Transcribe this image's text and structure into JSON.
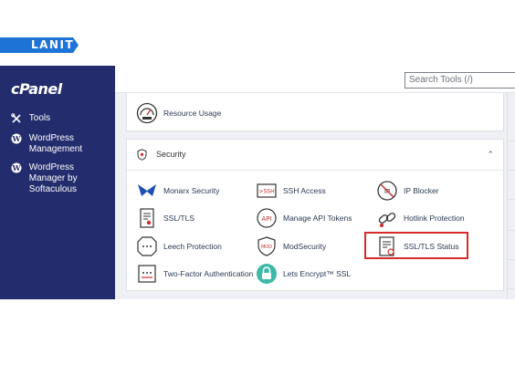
{
  "brand": {
    "lanit_logo": "LANIT",
    "cpanel_logo": "cPanel"
  },
  "sidebar": {
    "items": [
      {
        "label": "Tools",
        "icon": "tools-icon"
      },
      {
        "label": "WordPress Management",
        "icon": "wordpress-icon"
      },
      {
        "label": "WordPress Manager by Softaculous",
        "icon": "wordpress-icon"
      }
    ]
  },
  "search": {
    "placeholder": "Search Tools (/)"
  },
  "resource": {
    "label": "Resource Usage",
    "icon": "gauge-icon"
  },
  "security": {
    "title": "Security",
    "tools": [
      {
        "label": "Monarx Security",
        "icon": "monarx-icon"
      },
      {
        "label": "SSH Access",
        "icon": "ssh-icon"
      },
      {
        "label": "IP Blocker",
        "icon": "ip-blocker-icon"
      },
      {
        "label": "SSL/TLS",
        "icon": "certificate-icon"
      },
      {
        "label": "Manage API Tokens",
        "icon": "api-icon"
      },
      {
        "label": "Hotlink Protection",
        "icon": "link-icon"
      },
      {
        "label": "Leech Protection",
        "icon": "leech-icon"
      },
      {
        "label": "ModSecurity",
        "icon": "modsecurity-icon"
      },
      {
        "label": "SSL/TLS Status",
        "icon": "ssl-status-icon"
      },
      {
        "label": "Two-Factor Authentication",
        "icon": "two-factor-icon"
      },
      {
        "label": "Lets Encrypt™ SSL",
        "icon": "lock-icon"
      }
    ]
  },
  "colors": {
    "sidebar_bg": "#232d6d",
    "lanit_blue": "#1e74d6",
    "highlight": "#d82a2a"
  }
}
